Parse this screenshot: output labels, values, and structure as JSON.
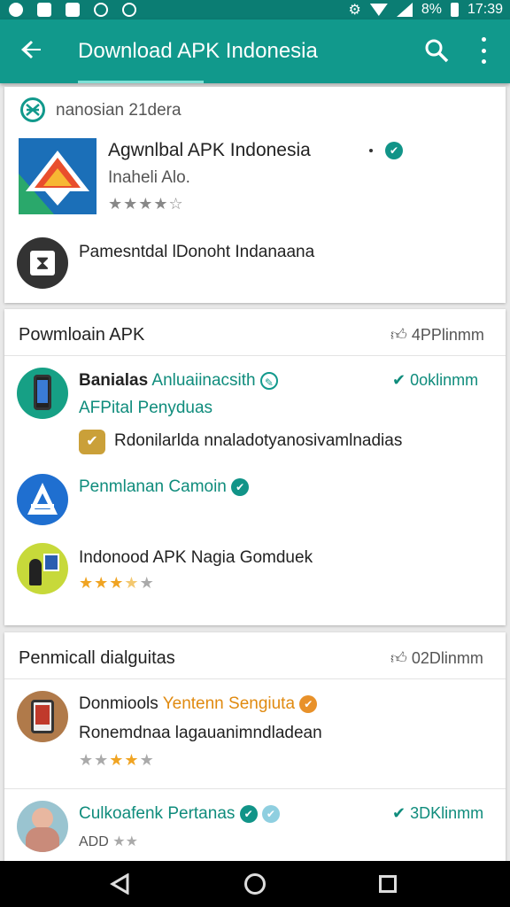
{
  "status": {
    "time": "17:39",
    "battery": "8%"
  },
  "appbar": {
    "title": "Download APK Indonesia"
  },
  "card1": {
    "header": "nanosian 21dera",
    "app": {
      "title": "Agwnlbal APK Indonesia",
      "subtitle": "Inaheli Alo.",
      "rating": 4
    },
    "promo": "Pamesntdal lDonoht Indanaana"
  },
  "card2": {
    "title": "Powmloain APK",
    "action": "4PPlinmm",
    "items": [
      {
        "name": "Banialas",
        "tag": "Anluaiinacsith",
        "action": "0oklinmm",
        "subtitle": "AFPital Penyduas",
        "extra": "Rdonilarlda nnaladotyanosivamlnadias"
      },
      {
        "name": "Penmlanan Camoin"
      },
      {
        "name": "Indonood APK Nagia Gomduek",
        "rating": 3.5
      }
    ]
  },
  "card3": {
    "title": "Penmicall dialguitas",
    "action": "02Dlinmm",
    "items": [
      {
        "name": "Donmiools",
        "tag": "Yentenn Sengiuta",
        "subtitle": "Ronemdnaa lagauanimndladean",
        "rating": 3
      },
      {
        "name": "Culkoafenk Pertanas",
        "action": "3DKlinmm",
        "subtitle": "ADD"
      }
    ]
  }
}
